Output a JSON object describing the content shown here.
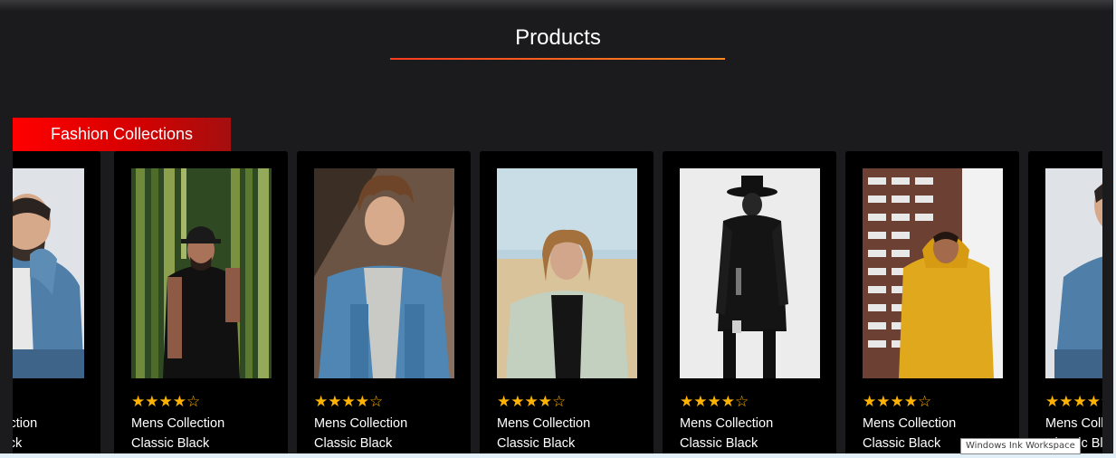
{
  "section": {
    "title": "Products",
    "category_tab": "Fashion Collections"
  },
  "colors": {
    "background": "#1b1b1d",
    "accent_red": "#ff0000",
    "underline": "#ff5a1f",
    "star": "#ffb300",
    "card": "#000000"
  },
  "products": [
    {
      "rating": 4,
      "rating_max": 5,
      "stars": "★★★★☆",
      "title": "Mens Collection",
      "subtitle": "Classic Black",
      "image": "man-denim-jacket"
    },
    {
      "rating": 4,
      "rating_max": 5,
      "stars": "★★★★☆",
      "title": "Mens Collection",
      "subtitle": "Classic Black",
      "image": "man-black-tee-bamboo"
    },
    {
      "rating": 4,
      "rating_max": 5,
      "stars": "★★★★☆",
      "title": "Mens Collection",
      "subtitle": "Classic Black",
      "image": "man-curly-denim"
    },
    {
      "rating": 4,
      "rating_max": 5,
      "stars": "★★★★☆",
      "title": "Mens Collection",
      "subtitle": "Classic Black",
      "image": "man-beach-jacket"
    },
    {
      "rating": 4,
      "rating_max": 5,
      "stars": "★★★★☆",
      "title": "Mens Collection",
      "subtitle": "Classic Black",
      "image": "man-black-coat-hat"
    },
    {
      "rating": 4,
      "rating_max": 5,
      "stars": "★★★★☆",
      "title": "Mens Collection",
      "subtitle": "Classic Black",
      "image": "man-yellow-hoodie"
    },
    {
      "rating": 4,
      "rating_max": 5,
      "stars": "★★★★☆",
      "title": "Mens Collection",
      "subtitle": "Classic Black",
      "image": "man-denim-jacket"
    }
  ],
  "tooltip": "Windows Ink Workspace"
}
